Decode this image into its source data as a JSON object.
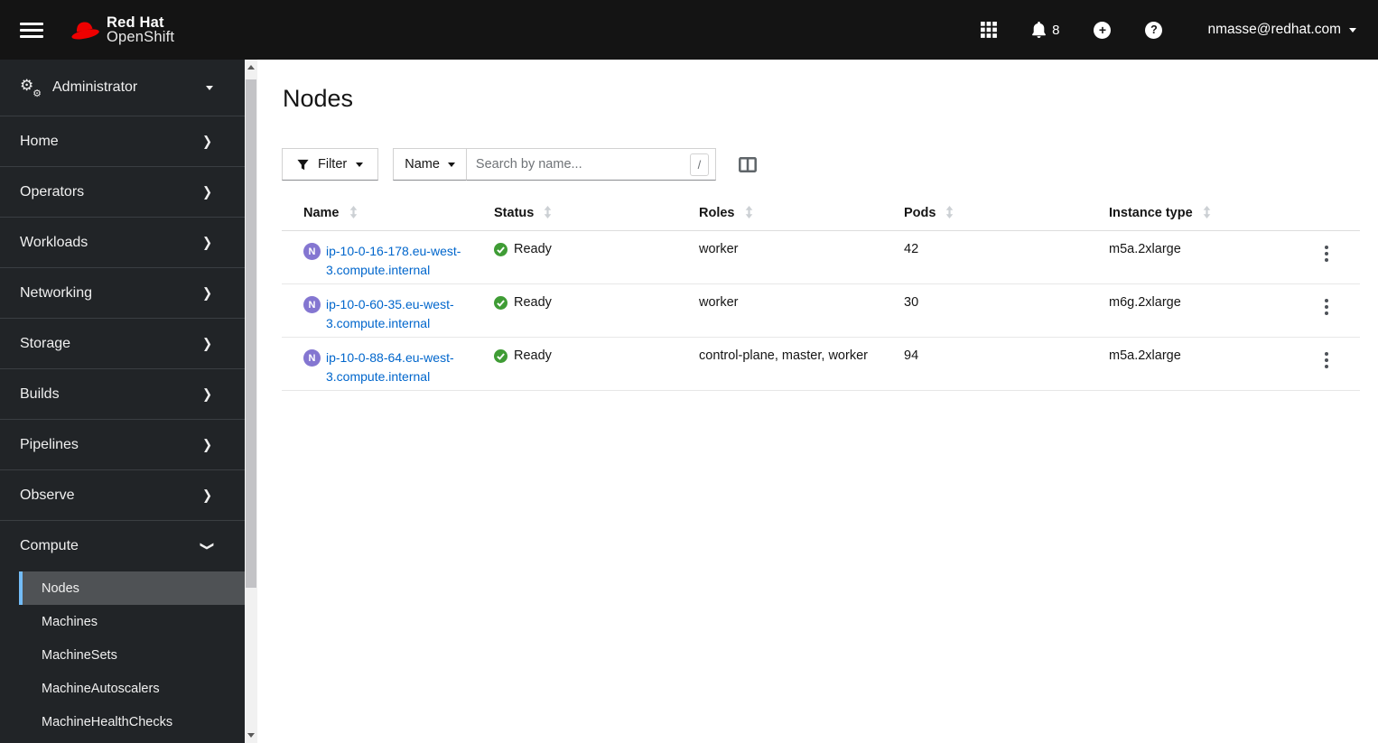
{
  "masthead": {
    "brand": {
      "line1": "Red Hat",
      "line2": "OpenShift"
    },
    "notification_count": "8",
    "user_menu": {
      "label": "nmasse@redhat.com"
    },
    "icons": [
      "menu-icon",
      "redhat-fedora-logo",
      "app-launcher-icon",
      "bell-icon",
      "plus-circle-icon",
      "help-icon",
      "caret-down-icon"
    ]
  },
  "sidebar": {
    "perspective": {
      "label": "Administrator",
      "icon": "cogs-icon"
    },
    "items": [
      {
        "label": "Home"
      },
      {
        "label": "Operators"
      },
      {
        "label": "Workloads"
      },
      {
        "label": "Networking"
      },
      {
        "label": "Storage"
      },
      {
        "label": "Builds"
      },
      {
        "label": "Pipelines"
      },
      {
        "label": "Observe"
      }
    ],
    "compute": {
      "label": "Compute",
      "expanded": true,
      "subitems": [
        {
          "label": "Nodes",
          "active": true
        },
        {
          "label": "Machines",
          "active": false
        },
        {
          "label": "MachineSets",
          "active": false
        },
        {
          "label": "MachineAutoscalers",
          "active": false
        },
        {
          "label": "MachineHealthChecks",
          "active": false
        }
      ]
    }
  },
  "page": {
    "title": "Nodes",
    "toolbar": {
      "filter_label": "Filter",
      "name_filter_label": "Name",
      "search_placeholder": "Search by name...",
      "search_shortcut": "/",
      "icons": [
        "filter-funnel-icon",
        "caret-down-icon",
        "column-management-icon"
      ]
    }
  },
  "table": {
    "columns": [
      {
        "label": "Name",
        "sortable": true
      },
      {
        "label": "Status",
        "sortable": true
      },
      {
        "label": "Roles",
        "sortable": true
      },
      {
        "label": "Pods",
        "sortable": true
      },
      {
        "label": "Instance type",
        "sortable": true
      }
    ],
    "rows": [
      {
        "badge": "N",
        "name": "ip-10-0-16-178.eu-west-3.compute.internal",
        "status": "Ready",
        "roles": "worker",
        "pods": "42",
        "instance_type": "m5a.2xlarge"
      },
      {
        "badge": "N",
        "name": "ip-10-0-60-35.eu-west-3.compute.internal",
        "status": "Ready",
        "roles": "worker",
        "pods": "30",
        "instance_type": "m6g.2xlarge"
      },
      {
        "badge": "N",
        "name": "ip-10-0-88-64.eu-west-3.compute.internal",
        "status": "Ready",
        "roles": "control-plane, master, worker",
        "pods": "94",
        "instance_type": "m5a.2xlarge"
      }
    ]
  },
  "colors": {
    "masthead_bg": "#141414",
    "sidebar_bg": "#212427",
    "active_nav_bg": "#4f5255",
    "active_nav_border": "#73bcf7",
    "link": "#0066cc",
    "success_green": "#3f9c35",
    "node_badge_purple": "#8476d1",
    "brand_red": "#ee0000"
  }
}
